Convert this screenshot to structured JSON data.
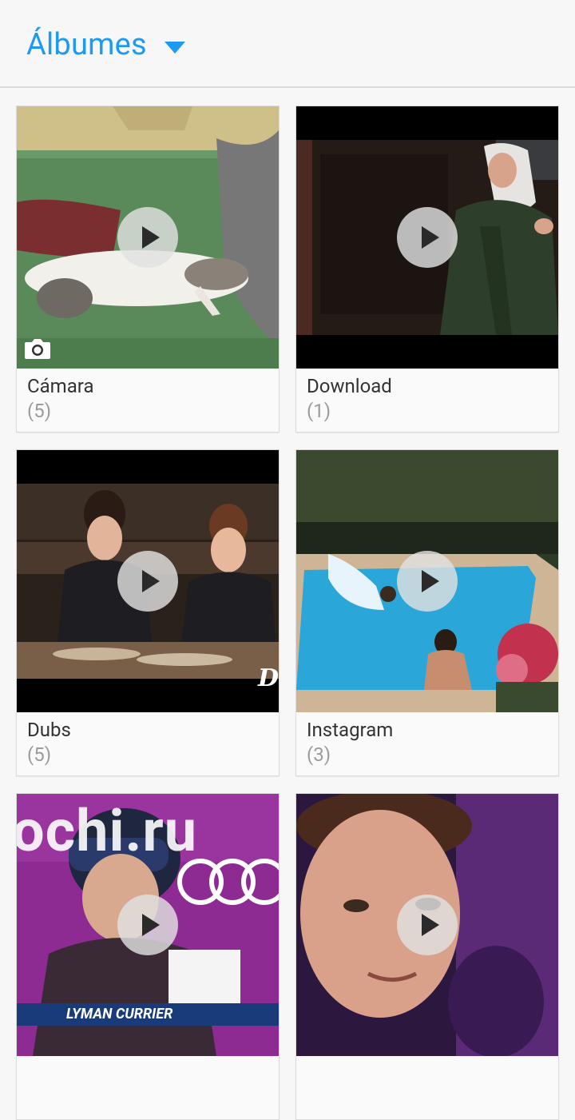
{
  "header": {
    "title": "Álbumes"
  },
  "albums": [
    {
      "name": "Cámara",
      "count": "(5)",
      "is_camera": true
    },
    {
      "name": "Download",
      "count": "(1)"
    },
    {
      "name": "Dubs",
      "count": "(5)"
    },
    {
      "name": "Instagram",
      "count": "(3)"
    },
    {
      "name": "",
      "count": ""
    },
    {
      "name": "",
      "count": ""
    }
  ],
  "thumb_overlay_text": {
    "dubs": "Du",
    "ski_banner": "LYMAN CURRIER",
    "ski_bg": "ochi.ru"
  },
  "colors": {
    "accent": "#1e9bf0"
  }
}
